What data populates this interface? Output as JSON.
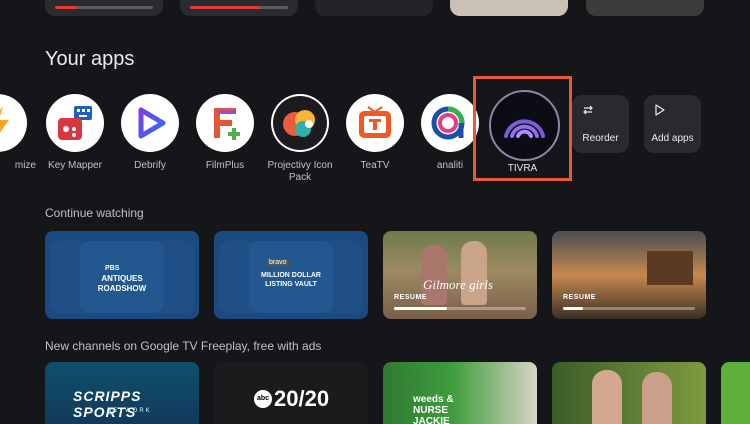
{
  "sections": {
    "your_apps": "Your apps",
    "continue_watching": "Continue watching",
    "new_channels": "New channels on Google TV Freeplay, free with ads"
  },
  "top_row": {
    "progress": [
      0.2,
      0.7
    ]
  },
  "apps": [
    {
      "label": "mize",
      "icon": "customize-icon"
    },
    {
      "label": "Key Mapper",
      "icon": "key-mapper-icon"
    },
    {
      "label": "Debrify",
      "icon": "debrify-icon"
    },
    {
      "label": "FilmPlus",
      "icon": "filmplus-icon"
    },
    {
      "label": "Projectivy Icon Pack",
      "icon": "projectivy-icon"
    },
    {
      "label": "TeaTV",
      "icon": "teatv-icon"
    },
    {
      "label": "analiti",
      "icon": "analiti-icon"
    },
    {
      "label": "TIVRA",
      "icon": "tivra-icon",
      "focused": true
    }
  ],
  "actions": {
    "reorder": "Reorder",
    "add_apps": "Add apps"
  },
  "continue_watching": [
    {
      "title": "ANTIQUES ROADSHOW",
      "network": "PBS"
    },
    {
      "title": "MILLION DOLLAR LISTING VAULT",
      "network": "bravo"
    },
    {
      "title": "Gilmore girls",
      "resume": "RESUME",
      "progress": 0.4
    },
    {
      "title": "",
      "resume": "RESUME",
      "progress": 0.15
    }
  ],
  "channels": [
    {
      "title": "SCRIPPS SPORTS",
      "sub": "NETWORK"
    },
    {
      "title": "20/20",
      "network": "abc"
    },
    {
      "title": "weeds & NURSE JACKIE"
    },
    {
      "title": ""
    }
  ],
  "colors": {
    "focus": "#e85a34",
    "progress": "#e53935",
    "background": "#151619"
  }
}
